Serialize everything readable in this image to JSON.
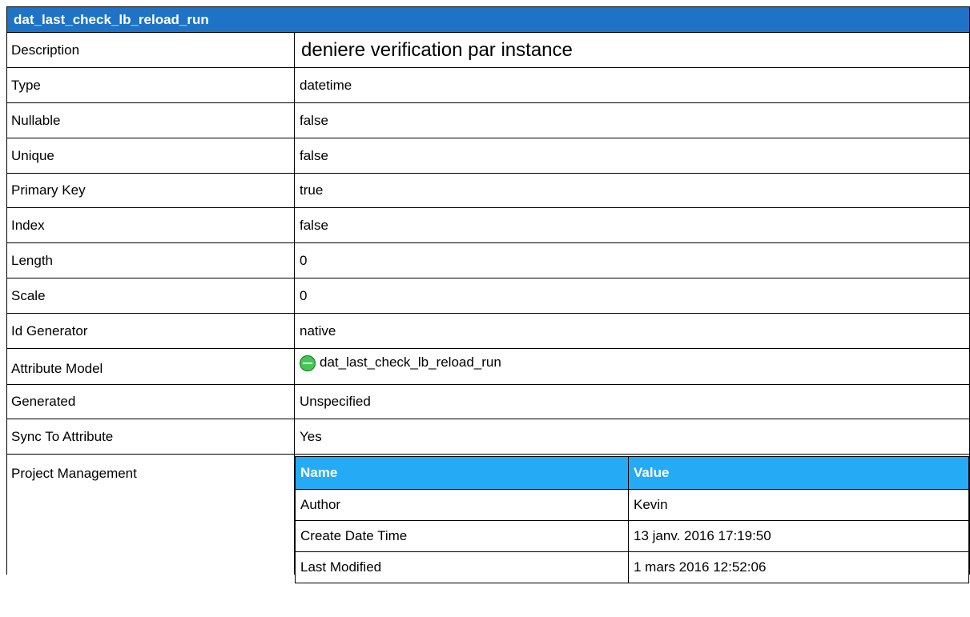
{
  "colors": {
    "title_bar": "#1f73c6",
    "subtable_header": "#25aaf5"
  },
  "title": "dat_last_check_lb_reload_run",
  "properties": {
    "description": {
      "label": "Description",
      "value": "deniere verification par instance"
    },
    "type": {
      "label": "Type",
      "value": "datetime"
    },
    "nullable": {
      "label": "Nullable",
      "value": "false"
    },
    "unique": {
      "label": "Unique",
      "value": "false"
    },
    "primary_key": {
      "label": "Primary Key",
      "value": "true"
    },
    "index": {
      "label": "Index",
      "value": "false"
    },
    "length": {
      "label": "Length",
      "value": "0"
    },
    "scale": {
      "label": "Scale",
      "value": "0"
    },
    "id_generator": {
      "label": "Id Generator",
      "value": "native"
    },
    "attribute_model": {
      "label": "Attribute Model",
      "value": "dat_last_check_lb_reload_run",
      "icon": "entity-icon"
    },
    "generated": {
      "label": "Generated",
      "value": "Unspecified"
    },
    "sync_to_attribute": {
      "label": "Sync To Attribute",
      "value": "Yes"
    }
  },
  "project_management": {
    "label": "Project Management",
    "columns": [
      "Name",
      "Value"
    ],
    "rows": [
      [
        "Author",
        "Kevin"
      ],
      [
        "Create Date Time",
        "13 janv. 2016 17:19:50"
      ],
      [
        "Last Modified",
        "1 mars 2016 12:52:06"
      ]
    ]
  }
}
